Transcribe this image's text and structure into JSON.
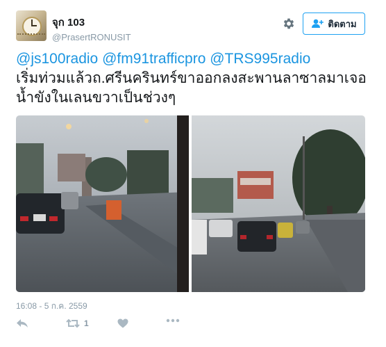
{
  "author": {
    "display_name": "จุก 103",
    "username": "@PrasertRONUSIT"
  },
  "follow_button_label": "ติดตาม",
  "tweet": {
    "mentions": [
      "@js100radio",
      "@fm91trafficpro",
      "@TRS995radio"
    ],
    "text": "เริ่มท่วมแล้วถ.ศรีนครินทร์ขาออกลงสะพานลาซาลมาเจอน้ำขังในเลนขวาเป็นช่วงๆ"
  },
  "timestamp": "16:08 - 5 ก.ค. 2559",
  "actions": {
    "retweet_count": "1"
  },
  "icons": {
    "settings": "gear-icon",
    "follow": "add-user-icon",
    "reply": "reply-icon",
    "retweet": "retweet-icon",
    "like": "heart-icon",
    "more": "more-icon"
  },
  "colors": {
    "link": "#1b95e0",
    "follow_border": "#1da1f2",
    "muted": "#8899a6"
  }
}
